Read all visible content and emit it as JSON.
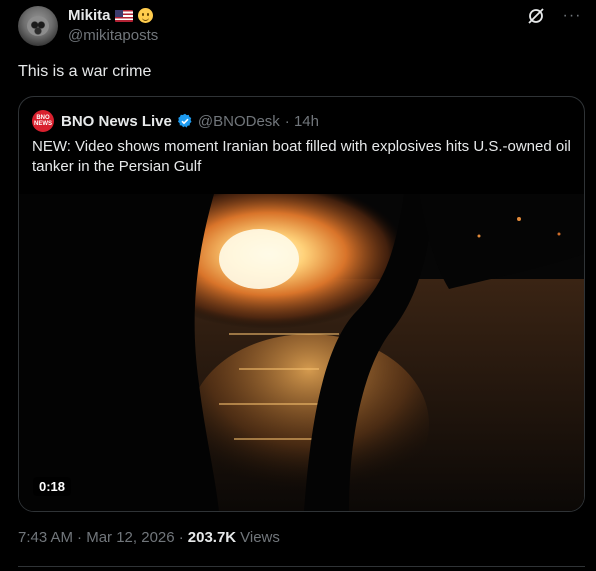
{
  "post": {
    "author": {
      "display_name": "Mikita",
      "handle": "@mikitaposts",
      "badges": [
        "us-flag-emoji",
        "saluting-face-emoji"
      ]
    },
    "actions": {
      "grok_icon": "grok-icon",
      "more_icon": "more-icon",
      "more_label": "···"
    },
    "text": "This is a war crime",
    "quote": {
      "avatar_text": [
        "BNO",
        "NEWS"
      ],
      "display_name": "BNO News Live",
      "verified": true,
      "handle": "@BNODesk",
      "time": "· 14h",
      "text": "NEW: Video shows moment Iranian boat filled with explosives hits U.S.-owned oil tanker in the Persian Gulf",
      "media": {
        "type": "video",
        "duration": "0:18"
      }
    },
    "meta": {
      "time": "7:43 AM",
      "date": "· Mar 12, 2026 ·",
      "views_count": "203.7K",
      "views_label": "Views"
    }
  },
  "colors": {
    "background": "#000000",
    "text_primary": "#e7e9ea",
    "text_secondary": "#71767b",
    "border": "#2f3336",
    "verified": "#1d9bf0",
    "bno_red": "#d9202e"
  }
}
